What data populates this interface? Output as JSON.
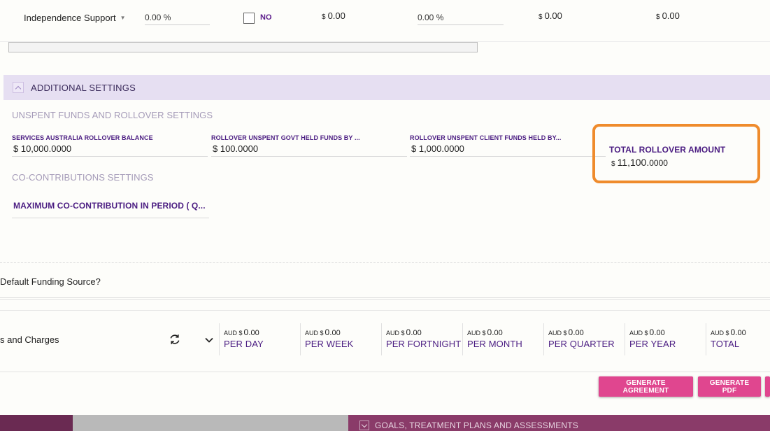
{
  "top_row": {
    "service_label": "Independence Support",
    "percent_1": "0.00 %",
    "checkbox_label": "NO",
    "amount_1": "0.00",
    "percent_2": "0.00 %",
    "amount_2": "0.00",
    "amount_3": "0.00",
    "currency_symbol": "$"
  },
  "additional_settings": {
    "title": "ADDITIONAL SETTINGS",
    "unspent_title": "UNSPENT FUNDS AND ROLLOVER SETTINGS",
    "rollover_fields": [
      {
        "label": "SERVICES AUSTRALIA ROLLOVER BALANCE",
        "value": "$ 10,000.0000"
      },
      {
        "label": "ROLLOVER UNSPENT GOVT HELD FUNDS BY ...",
        "value": "$ 100.0000"
      },
      {
        "label": "ROLLOVER UNSPENT CLIENT FUNDS HELD BY...",
        "value": "$ 1,000.0000"
      }
    ],
    "total_rollover": {
      "label": "TOTAL ROLLOVER AMOUNT",
      "currency": "$",
      "whole": "11,100.",
      "decimal": "0000"
    },
    "cocontrib_title": "CO-CONTRIBUTIONS SETTINGS",
    "cocontrib_field_label": "MAXIMUM CO-CONTRIBUTION IN PERIOD ( Q..."
  },
  "default_funding_source": "Default Funding Source?",
  "fees": {
    "title": "s and Charges",
    "columns": [
      {
        "currency": "AUD $",
        "whole": "0.",
        "decimal": "00",
        "period": "PER DAY"
      },
      {
        "currency": "AUD $",
        "whole": "0.",
        "decimal": "00",
        "period": "PER WEEK"
      },
      {
        "currency": "AUD $",
        "whole": "0.",
        "decimal": "00",
        "period": "PER FORTNIGHT"
      },
      {
        "currency": "AUD $",
        "whole": "0.",
        "decimal": "00",
        "period": "PER MONTH"
      },
      {
        "currency": "AUD $",
        "whole": "0.",
        "decimal": "00",
        "period": "PER QUARTER"
      },
      {
        "currency": "AUD $",
        "whole": "0.",
        "decimal": "00",
        "period": "PER YEAR"
      },
      {
        "currency": "AUD $",
        "whole": "0.",
        "decimal": "00",
        "period": "TOTAL"
      }
    ]
  },
  "buttons": {
    "generate_agreement": "GENERATE AGREEMENT",
    "generate_pdf": "GENERATE PDF"
  },
  "backdrop": {
    "goals_title": "GOALS, TREATMENT PLANS AND ASSESSMENTS"
  },
  "colors": {
    "accent_purple": "#4b1d82",
    "highlight_orange": "#ef8b2c",
    "button_pink": "#e0468f",
    "header_lavender": "#e6dff2"
  },
  "icons": [
    "chevron-down-icon",
    "refresh-icon",
    "checkbox-icon",
    "collapse-icon"
  ]
}
